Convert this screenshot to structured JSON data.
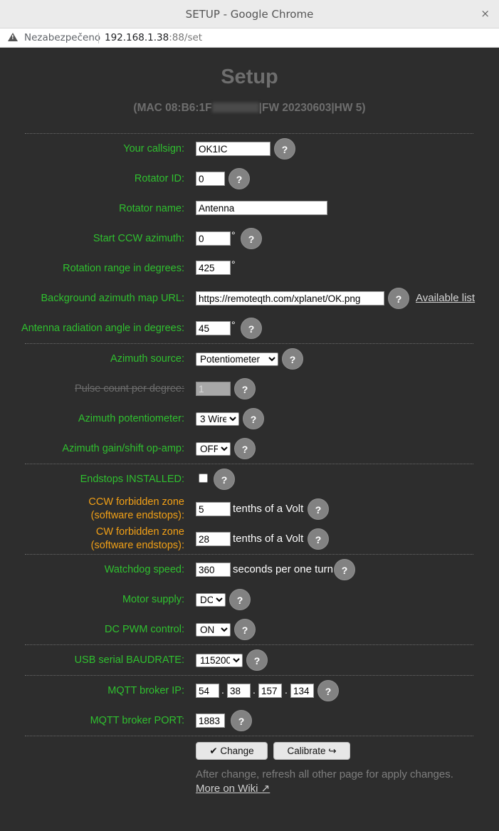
{
  "browser": {
    "window_title": "SETUP - Google Chrome",
    "close_glyph": "×",
    "security_label": "Nezabezpečeno",
    "url_host": "192.168.1.38",
    "url_rest": ":88/set"
  },
  "page": {
    "title": "Setup",
    "subtitle_prefix": "(MAC 08:B6:1F",
    "subtitle_suffix": "|FW 20230603|HW 5)"
  },
  "help_glyph": "?",
  "degree_glyph": "°",
  "fields": {
    "callsign": {
      "label": "Your callsign:",
      "value": "OK1IC"
    },
    "rotator_id": {
      "label": "Rotator ID:",
      "value": "0"
    },
    "rotator_name": {
      "label": "Rotator name:",
      "value": "Antenna"
    },
    "start_ccw": {
      "label": "Start CCW azimuth:",
      "value": "0"
    },
    "rotation_range": {
      "label": "Rotation range in degrees:",
      "value": "425"
    },
    "map_url": {
      "label": "Background azimuth map URL:",
      "value": "https://remoteqth.com/xplanet/OK.png",
      "link": "Available list"
    },
    "radiation_angle": {
      "label": "Antenna radiation angle in degrees:",
      "value": "45"
    },
    "azimuth_source": {
      "label": "Azimuth source:",
      "selected": "Potentiometer"
    },
    "pulse_count": {
      "label": "Pulse count per degree:",
      "value": "1"
    },
    "azimuth_pot": {
      "label": "Azimuth potentiometer:",
      "selected": "3 Wire"
    },
    "gain_shift": {
      "label": "Azimuth gain/shift op-amp:",
      "selected": "OFF"
    },
    "endstops": {
      "label": "Endstops INSTALLED:",
      "checked": false
    },
    "ccw_zone": {
      "label_line1": "CCW forbidden zone",
      "label_line2": "(software endstops):",
      "value": "5",
      "unit": "tenths of a Volt"
    },
    "cw_zone": {
      "label_line1": "CW forbidden zone",
      "label_line2": "(software endstops):",
      "value": "28",
      "unit": "tenths of a Volt"
    },
    "watchdog": {
      "label": "Watchdog speed:",
      "value": "360",
      "unit": "seconds per one turn"
    },
    "motor_supply": {
      "label": "Motor supply:",
      "selected": "DC"
    },
    "pwm": {
      "label": "DC PWM control:",
      "selected": "ON"
    },
    "baudrate": {
      "label": "USB serial BAUDRATE:",
      "selected": "115200"
    },
    "mqtt_ip": {
      "label": "MQTT broker IP:",
      "octets": [
        "54",
        "38",
        "157",
        "134"
      ],
      "dot": "."
    },
    "mqtt_port": {
      "label": "MQTT broker PORT:",
      "value": "1883"
    }
  },
  "buttons": {
    "change": "✔ Change",
    "calibrate": "Calibrate ↪"
  },
  "footer": {
    "note": "After change, refresh all other page for apply changes.",
    "wiki": "More on Wiki ↗"
  },
  "colors": {
    "label_green": "#2fc02f",
    "label_orange": "#f2a016",
    "background": "#2d2d2d"
  }
}
